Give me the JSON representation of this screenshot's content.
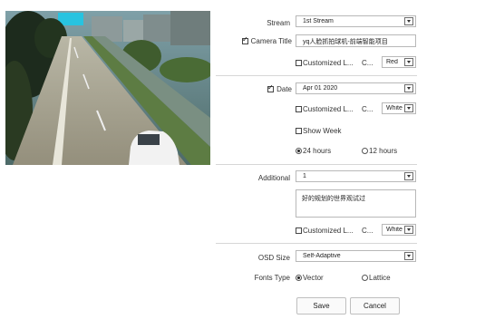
{
  "stream": {
    "label": "Stream",
    "value": "1st Stream"
  },
  "camera_title": {
    "label": "Camera Title",
    "value": "yq人脸抓拍球机-前端智能项目",
    "checked": true
  },
  "customized1": {
    "label": "Customized L...",
    "c_label": "C...",
    "color_value": "Red"
  },
  "date": {
    "label": "Date",
    "value": "Apr 01 2020",
    "checked": true
  },
  "customized2": {
    "label": "Customized L...",
    "c_label": "C...",
    "color_value": "White"
  },
  "show_week": {
    "label": "Show Week"
  },
  "time_format": {
    "opt1": "24 hours",
    "opt2": "12 hours",
    "selected": "24 hours"
  },
  "additional": {
    "label": "Additional",
    "value": "1",
    "text": "好的规划的世界观试过"
  },
  "customized3": {
    "label": "Customized L...",
    "c_label": "C...",
    "color_value": "White"
  },
  "osd_size": {
    "label": "OSD Size",
    "value": "Self-Adaptive"
  },
  "fonts_type": {
    "label": "Fonts Type",
    "opt1": "Vector",
    "opt2": "Lattice",
    "selected": "Vector"
  },
  "buttons": {
    "save": "Save",
    "cancel": "Cancel"
  }
}
